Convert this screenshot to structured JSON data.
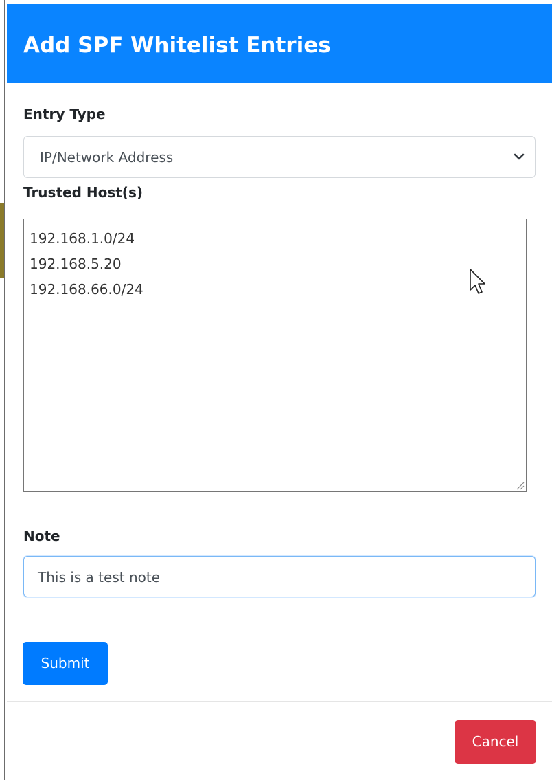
{
  "modal": {
    "title": "Add SPF Whitelist Entries",
    "header_color": "#0a84ff"
  },
  "entry_type": {
    "label": "Entry Type",
    "selected": "IP/Network Address",
    "icon": "chevron-down-icon"
  },
  "trusted_hosts": {
    "label": "Trusted Host(s)",
    "lines": [
      "192.168.1.0/24",
      "192.168.5.20",
      "192.168.66.0/24"
    ]
  },
  "note": {
    "label": "Note",
    "value": "This is a test note"
  },
  "buttons": {
    "submit_label": "Submit",
    "submit_color": "#007bff",
    "cancel_label": "Cancel",
    "cancel_color": "#dc3545"
  },
  "cursor": {
    "icon": "mouse-pointer-icon"
  }
}
